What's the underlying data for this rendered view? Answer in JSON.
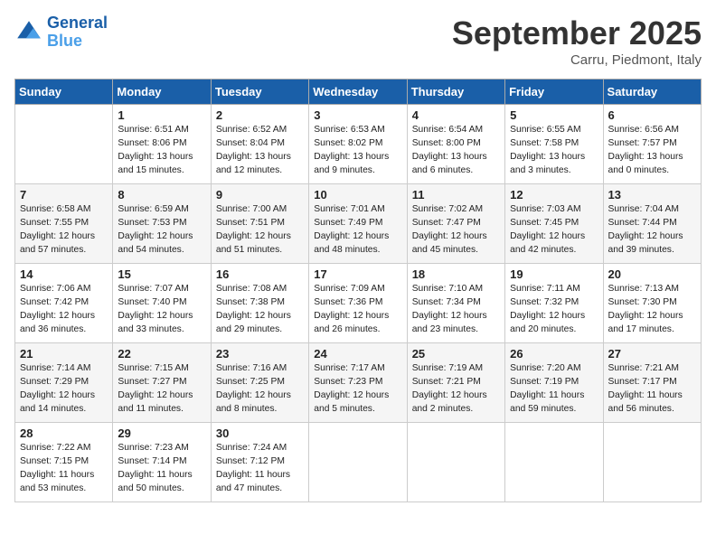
{
  "header": {
    "logo_line1": "General",
    "logo_line2": "Blue",
    "month_title": "September 2025",
    "location": "Carru, Piedmont, Italy"
  },
  "days_of_week": [
    "Sunday",
    "Monday",
    "Tuesday",
    "Wednesday",
    "Thursday",
    "Friday",
    "Saturday"
  ],
  "weeks": [
    [
      {
        "day": "",
        "info": ""
      },
      {
        "day": "1",
        "info": "Sunrise: 6:51 AM\nSunset: 8:06 PM\nDaylight: 13 hours\nand 15 minutes."
      },
      {
        "day": "2",
        "info": "Sunrise: 6:52 AM\nSunset: 8:04 PM\nDaylight: 13 hours\nand 12 minutes."
      },
      {
        "day": "3",
        "info": "Sunrise: 6:53 AM\nSunset: 8:02 PM\nDaylight: 13 hours\nand 9 minutes."
      },
      {
        "day": "4",
        "info": "Sunrise: 6:54 AM\nSunset: 8:00 PM\nDaylight: 13 hours\nand 6 minutes."
      },
      {
        "day": "5",
        "info": "Sunrise: 6:55 AM\nSunset: 7:58 PM\nDaylight: 13 hours\nand 3 minutes."
      },
      {
        "day": "6",
        "info": "Sunrise: 6:56 AM\nSunset: 7:57 PM\nDaylight: 13 hours\nand 0 minutes."
      }
    ],
    [
      {
        "day": "7",
        "info": "Sunrise: 6:58 AM\nSunset: 7:55 PM\nDaylight: 12 hours\nand 57 minutes."
      },
      {
        "day": "8",
        "info": "Sunrise: 6:59 AM\nSunset: 7:53 PM\nDaylight: 12 hours\nand 54 minutes."
      },
      {
        "day": "9",
        "info": "Sunrise: 7:00 AM\nSunset: 7:51 PM\nDaylight: 12 hours\nand 51 minutes."
      },
      {
        "day": "10",
        "info": "Sunrise: 7:01 AM\nSunset: 7:49 PM\nDaylight: 12 hours\nand 48 minutes."
      },
      {
        "day": "11",
        "info": "Sunrise: 7:02 AM\nSunset: 7:47 PM\nDaylight: 12 hours\nand 45 minutes."
      },
      {
        "day": "12",
        "info": "Sunrise: 7:03 AM\nSunset: 7:45 PM\nDaylight: 12 hours\nand 42 minutes."
      },
      {
        "day": "13",
        "info": "Sunrise: 7:04 AM\nSunset: 7:44 PM\nDaylight: 12 hours\nand 39 minutes."
      }
    ],
    [
      {
        "day": "14",
        "info": "Sunrise: 7:06 AM\nSunset: 7:42 PM\nDaylight: 12 hours\nand 36 minutes."
      },
      {
        "day": "15",
        "info": "Sunrise: 7:07 AM\nSunset: 7:40 PM\nDaylight: 12 hours\nand 33 minutes."
      },
      {
        "day": "16",
        "info": "Sunrise: 7:08 AM\nSunset: 7:38 PM\nDaylight: 12 hours\nand 29 minutes."
      },
      {
        "day": "17",
        "info": "Sunrise: 7:09 AM\nSunset: 7:36 PM\nDaylight: 12 hours\nand 26 minutes."
      },
      {
        "day": "18",
        "info": "Sunrise: 7:10 AM\nSunset: 7:34 PM\nDaylight: 12 hours\nand 23 minutes."
      },
      {
        "day": "19",
        "info": "Sunrise: 7:11 AM\nSunset: 7:32 PM\nDaylight: 12 hours\nand 20 minutes."
      },
      {
        "day": "20",
        "info": "Sunrise: 7:13 AM\nSunset: 7:30 PM\nDaylight: 12 hours\nand 17 minutes."
      }
    ],
    [
      {
        "day": "21",
        "info": "Sunrise: 7:14 AM\nSunset: 7:29 PM\nDaylight: 12 hours\nand 14 minutes."
      },
      {
        "day": "22",
        "info": "Sunrise: 7:15 AM\nSunset: 7:27 PM\nDaylight: 12 hours\nand 11 minutes."
      },
      {
        "day": "23",
        "info": "Sunrise: 7:16 AM\nSunset: 7:25 PM\nDaylight: 12 hours\nand 8 minutes."
      },
      {
        "day": "24",
        "info": "Sunrise: 7:17 AM\nSunset: 7:23 PM\nDaylight: 12 hours\nand 5 minutes."
      },
      {
        "day": "25",
        "info": "Sunrise: 7:19 AM\nSunset: 7:21 PM\nDaylight: 12 hours\nand 2 minutes."
      },
      {
        "day": "26",
        "info": "Sunrise: 7:20 AM\nSunset: 7:19 PM\nDaylight: 11 hours\nand 59 minutes."
      },
      {
        "day": "27",
        "info": "Sunrise: 7:21 AM\nSunset: 7:17 PM\nDaylight: 11 hours\nand 56 minutes."
      }
    ],
    [
      {
        "day": "28",
        "info": "Sunrise: 7:22 AM\nSunset: 7:15 PM\nDaylight: 11 hours\nand 53 minutes."
      },
      {
        "day": "29",
        "info": "Sunrise: 7:23 AM\nSunset: 7:14 PM\nDaylight: 11 hours\nand 50 minutes."
      },
      {
        "day": "30",
        "info": "Sunrise: 7:24 AM\nSunset: 7:12 PM\nDaylight: 11 hours\nand 47 minutes."
      },
      {
        "day": "",
        "info": ""
      },
      {
        "day": "",
        "info": ""
      },
      {
        "day": "",
        "info": ""
      },
      {
        "day": "",
        "info": ""
      }
    ]
  ]
}
